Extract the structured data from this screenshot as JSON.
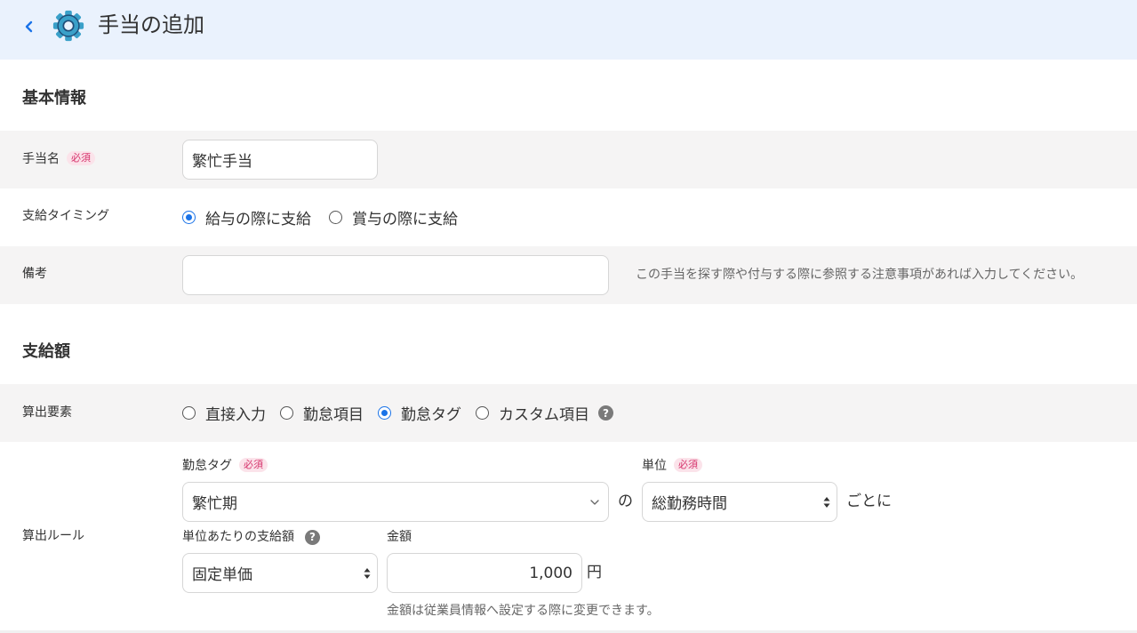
{
  "header": {
    "title": "手当の追加",
    "accent_color": "#3aa0c9"
  },
  "basic_info": {
    "heading": "基本情報",
    "name": {
      "label": "手当名",
      "badge": "必須",
      "value": "繁忙手当"
    },
    "timing": {
      "label": "支給タイミング",
      "options": [
        {
          "label": "給与の際に支給",
          "checked": true
        },
        {
          "label": "賞与の際に支給",
          "checked": false
        }
      ]
    },
    "note": {
      "label": "備考",
      "value": "",
      "hint": "この手当を探す際や付与する際に参照する注意事項があれば入力してください。"
    }
  },
  "payment": {
    "heading": "支給額",
    "calc_element": {
      "label": "算出要素",
      "options": [
        {
          "label": "直接入力",
          "checked": false
        },
        {
          "label": "勤怠項目",
          "checked": false
        },
        {
          "label": "勤怠タグ",
          "checked": true
        },
        {
          "label": "カスタム項目",
          "checked": false
        }
      ],
      "help_icon": "?"
    },
    "calc_rule": {
      "label": "算出ルール",
      "tag_label": "勤怠タグ",
      "tag_badge": "必須",
      "tag_value": "繁忙期",
      "of_text": "の",
      "unit_label": "単位",
      "unit_badge": "必須",
      "unit_value": "総勤務時間",
      "per_text": "ごとに",
      "per_unit_label": "単位あたりの支給額",
      "per_unit_help": "?",
      "per_unit_value": "固定単価",
      "amount_label": "金額",
      "amount_value": "1,000",
      "currency": "円",
      "amount_hint": "金額は従業員情報へ設定する際に変更できます。"
    }
  }
}
